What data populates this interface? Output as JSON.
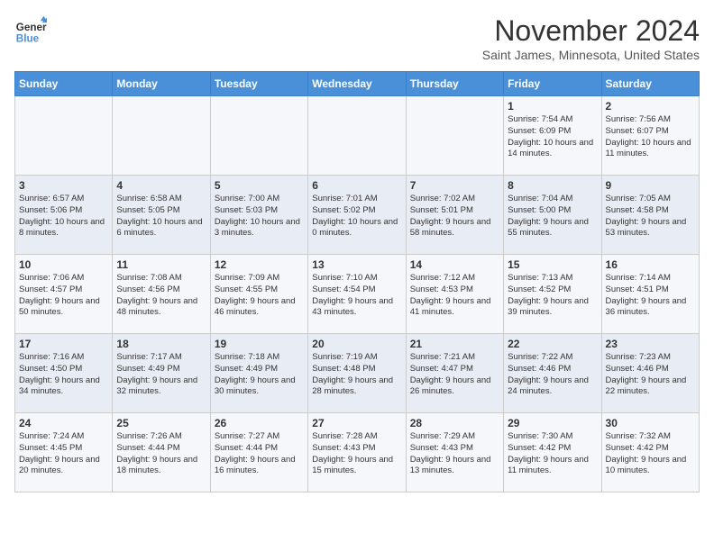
{
  "logo": {
    "line1": "General",
    "line2": "Blue"
  },
  "title": "November 2024",
  "subtitle": "Saint James, Minnesota, United States",
  "days_of_week": [
    "Sunday",
    "Monday",
    "Tuesday",
    "Wednesday",
    "Thursday",
    "Friday",
    "Saturday"
  ],
  "weeks": [
    [
      {
        "day": "",
        "info": ""
      },
      {
        "day": "",
        "info": ""
      },
      {
        "day": "",
        "info": ""
      },
      {
        "day": "",
        "info": ""
      },
      {
        "day": "",
        "info": ""
      },
      {
        "day": "1",
        "info": "Sunrise: 7:54 AM\nSunset: 6:09 PM\nDaylight: 10 hours and 14 minutes."
      },
      {
        "day": "2",
        "info": "Sunrise: 7:56 AM\nSunset: 6:07 PM\nDaylight: 10 hours and 11 minutes."
      }
    ],
    [
      {
        "day": "3",
        "info": "Sunrise: 6:57 AM\nSunset: 5:06 PM\nDaylight: 10 hours and 8 minutes."
      },
      {
        "day": "4",
        "info": "Sunrise: 6:58 AM\nSunset: 5:05 PM\nDaylight: 10 hours and 6 minutes."
      },
      {
        "day": "5",
        "info": "Sunrise: 7:00 AM\nSunset: 5:03 PM\nDaylight: 10 hours and 3 minutes."
      },
      {
        "day": "6",
        "info": "Sunrise: 7:01 AM\nSunset: 5:02 PM\nDaylight: 10 hours and 0 minutes."
      },
      {
        "day": "7",
        "info": "Sunrise: 7:02 AM\nSunset: 5:01 PM\nDaylight: 9 hours and 58 minutes."
      },
      {
        "day": "8",
        "info": "Sunrise: 7:04 AM\nSunset: 5:00 PM\nDaylight: 9 hours and 55 minutes."
      },
      {
        "day": "9",
        "info": "Sunrise: 7:05 AM\nSunset: 4:58 PM\nDaylight: 9 hours and 53 minutes."
      }
    ],
    [
      {
        "day": "10",
        "info": "Sunrise: 7:06 AM\nSunset: 4:57 PM\nDaylight: 9 hours and 50 minutes."
      },
      {
        "day": "11",
        "info": "Sunrise: 7:08 AM\nSunset: 4:56 PM\nDaylight: 9 hours and 48 minutes."
      },
      {
        "day": "12",
        "info": "Sunrise: 7:09 AM\nSunset: 4:55 PM\nDaylight: 9 hours and 46 minutes."
      },
      {
        "day": "13",
        "info": "Sunrise: 7:10 AM\nSunset: 4:54 PM\nDaylight: 9 hours and 43 minutes."
      },
      {
        "day": "14",
        "info": "Sunrise: 7:12 AM\nSunset: 4:53 PM\nDaylight: 9 hours and 41 minutes."
      },
      {
        "day": "15",
        "info": "Sunrise: 7:13 AM\nSunset: 4:52 PM\nDaylight: 9 hours and 39 minutes."
      },
      {
        "day": "16",
        "info": "Sunrise: 7:14 AM\nSunset: 4:51 PM\nDaylight: 9 hours and 36 minutes."
      }
    ],
    [
      {
        "day": "17",
        "info": "Sunrise: 7:16 AM\nSunset: 4:50 PM\nDaylight: 9 hours and 34 minutes."
      },
      {
        "day": "18",
        "info": "Sunrise: 7:17 AM\nSunset: 4:49 PM\nDaylight: 9 hours and 32 minutes."
      },
      {
        "day": "19",
        "info": "Sunrise: 7:18 AM\nSunset: 4:49 PM\nDaylight: 9 hours and 30 minutes."
      },
      {
        "day": "20",
        "info": "Sunrise: 7:19 AM\nSunset: 4:48 PM\nDaylight: 9 hours and 28 minutes."
      },
      {
        "day": "21",
        "info": "Sunrise: 7:21 AM\nSunset: 4:47 PM\nDaylight: 9 hours and 26 minutes."
      },
      {
        "day": "22",
        "info": "Sunrise: 7:22 AM\nSunset: 4:46 PM\nDaylight: 9 hours and 24 minutes."
      },
      {
        "day": "23",
        "info": "Sunrise: 7:23 AM\nSunset: 4:46 PM\nDaylight: 9 hours and 22 minutes."
      }
    ],
    [
      {
        "day": "24",
        "info": "Sunrise: 7:24 AM\nSunset: 4:45 PM\nDaylight: 9 hours and 20 minutes."
      },
      {
        "day": "25",
        "info": "Sunrise: 7:26 AM\nSunset: 4:44 PM\nDaylight: 9 hours and 18 minutes."
      },
      {
        "day": "26",
        "info": "Sunrise: 7:27 AM\nSunset: 4:44 PM\nDaylight: 9 hours and 16 minutes."
      },
      {
        "day": "27",
        "info": "Sunrise: 7:28 AM\nSunset: 4:43 PM\nDaylight: 9 hours and 15 minutes."
      },
      {
        "day": "28",
        "info": "Sunrise: 7:29 AM\nSunset: 4:43 PM\nDaylight: 9 hours and 13 minutes."
      },
      {
        "day": "29",
        "info": "Sunrise: 7:30 AM\nSunset: 4:42 PM\nDaylight: 9 hours and 11 minutes."
      },
      {
        "day": "30",
        "info": "Sunrise: 7:32 AM\nSunset: 4:42 PM\nDaylight: 9 hours and 10 minutes."
      }
    ]
  ]
}
